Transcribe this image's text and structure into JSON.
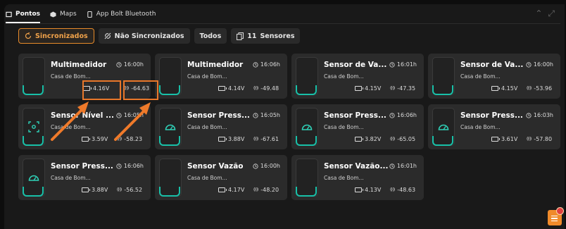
{
  "tabs": [
    {
      "label": "Pontos",
      "icon": "square-icon"
    },
    {
      "label": "Maps",
      "icon": "cube-icon"
    },
    {
      "label": "App Bolt Bluetooth",
      "icon": "phone-icon"
    }
  ],
  "filters": {
    "synced": "Sincronizados",
    "unsynced": "Não Sincronizados",
    "all": "Todos",
    "sensors_count": "11",
    "sensors_label": "Sensores"
  },
  "colors": {
    "accent": "#f0a24a",
    "teal": "#18c0a8",
    "card": "#2b2b2b",
    "highlight": "#e8772a"
  },
  "cards": [
    {
      "name": "Multimedidor",
      "time": "16:00h",
      "location": "Casa de Bom...",
      "battery": "4.16V",
      "signal": "-64.63",
      "icon": "none"
    },
    {
      "name": "Multimedidor",
      "time": "16:06h",
      "location": "Casa de Bom...",
      "battery": "4.14V",
      "signal": "-49.48",
      "icon": "none"
    },
    {
      "name": "Sensor de Va...",
      "time": "16:01h",
      "location": "Casa de Bom...",
      "battery": "4.15V",
      "signal": "-47.35",
      "icon": "none"
    },
    {
      "name": "Sensor de Va...",
      "time": "16:00h",
      "location": "Casa de Bom...",
      "battery": "4.15V",
      "signal": "-53.96",
      "icon": "none"
    },
    {
      "name": "Sensor Nível ...",
      "time": "16:05h",
      "location": "Casa de Bom...",
      "battery": "3.59V",
      "signal": "-58.23",
      "icon": "level"
    },
    {
      "name": "Sensor Press...",
      "time": "16:05h",
      "location": "Casa de Bom...",
      "battery": "3.88V",
      "signal": "-67.61",
      "icon": "gauge"
    },
    {
      "name": "Sensor Press...",
      "time": "16:06h",
      "location": "Casa de Bom...",
      "battery": "3.82V",
      "signal": "-65.05",
      "icon": "gauge"
    },
    {
      "name": "Sensor Press...",
      "time": "16:03h",
      "location": "Casa de Bom...",
      "battery": "3.61V",
      "signal": "-57.80",
      "icon": "gauge"
    },
    {
      "name": "Sensor Press...",
      "time": "16:06h",
      "location": "Casa de Bom...",
      "battery": "3.88V",
      "signal": "-56.52",
      "icon": "gauge"
    },
    {
      "name": "Sensor Vazão",
      "time": "16:00h",
      "location": "Casa de Bom...",
      "battery": "4.17V",
      "signal": "-48.20",
      "icon": "none"
    },
    {
      "name": "Sensor Vazão...",
      "time": "16:01h",
      "location": "Casa de Bom...",
      "battery": "4.13V",
      "signal": "-48.63",
      "icon": "none"
    }
  ]
}
